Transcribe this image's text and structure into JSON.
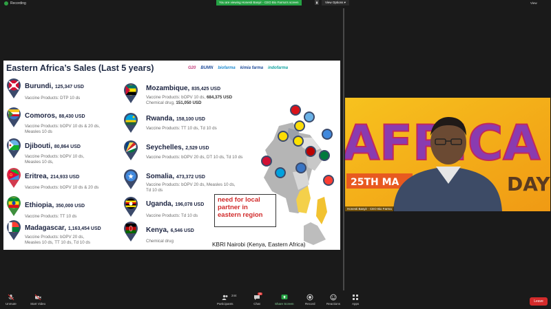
{
  "topbar": {
    "recording": "Recording",
    "viewing": "You are viewing Honesti Basyir - CEO Bio Farma's screen",
    "view_options": "View Options ▾",
    "view": "View"
  },
  "slide": {
    "title": "Eastern Africa’s Sales (Last 5 years)",
    "logos": [
      "G20",
      "BUMN",
      "biofarma",
      "kimia farma",
      "indofarma"
    ],
    "left": [
      {
        "country": "Burundi,",
        "amount": "125,347 USD",
        "products": [
          "Vaccine Products: DTP 10 ds"
        ]
      },
      {
        "country": "Comoros,",
        "amount": "88,430 USD",
        "products": [
          "Vaccine Products: bOPV 10 ds & 20 ds,",
          "Measles 10 ds"
        ]
      },
      {
        "country": "Djibouti,",
        "amount": "80,864 USD",
        "products": [
          "Vaccine Products: bOPV 10 ds,",
          "Measles 10 ds,"
        ]
      },
      {
        "country": "Eritrea,",
        "amount": "214,933 USD",
        "products": [
          "Vaccine Products: bOPV 10 ds & 20 ds"
        ]
      },
      {
        "country": "Ethiopia,",
        "amount": "350,000 USD",
        "products": [
          "Vaccine Products: TT 10 ds"
        ]
      },
      {
        "country": "Madagascar,",
        "amount": "1,163,454 USD",
        "products": [
          "Vaccine Products: bOPV 20 ds,",
          "Measles 10 ds, TT 10 ds, Td 10 ds"
        ]
      }
    ],
    "right": [
      {
        "country": "Mozambique,",
        "amount": "835,425 USD",
        "products": [
          "Vaccine Products: bOPV 10 ds,"
        ],
        "extra_amount": "684,375 USD",
        "chem": "Chemical drug,",
        "chem_amount": "151,050 USD"
      },
      {
        "country": "Rwanda,",
        "amount": "158,100 USD",
        "products": [
          "Vaccine Products: TT 10 ds, Td 10 ds"
        ]
      },
      {
        "country": "Seychelles,",
        "amount": "2,529 USD",
        "products": [
          "Vaccine Products: bOPV 20 ds, DT 10 ds, Td 10 ds"
        ]
      },
      {
        "country": "Somalia,",
        "amount": "473,372 USD",
        "products": [
          "Vaccine Products: bOPV 20 ds, Measles 10 ds,",
          "Td 10 ds"
        ]
      },
      {
        "country": "Uganda,",
        "amount": "196,078 USD",
        "products": [
          "Vaccine Products: Td 10 ds"
        ]
      },
      {
        "country": "Kenya,",
        "amount": "6,546 USD",
        "products": [
          "Chemical drug"
        ]
      }
    ],
    "callout": [
      "need for local",
      "partner in",
      "eastern region"
    ],
    "kbri": "KBRI Nairobi (Kenya, Eastern Africa)"
  },
  "speaker": {
    "name": "Honesti Basyir - CEO Bio Farma",
    "banner_text": "AFRICA",
    "day_text": "DAY",
    "date_text": "25TH MA"
  },
  "toolbar": {
    "unmute": "Unmute",
    "start_video": "Start Video",
    "participants": "Participants",
    "participants_count": "244",
    "chat": "Chat",
    "chat_count": "33",
    "share_screen": "Share Screen",
    "record": "Record",
    "reactions": "Reactions",
    "apps": "Apps",
    "leave": "Leave"
  },
  "colors": {
    "zoom_green": "#25a244",
    "leave_red": "#d32b2b",
    "callout_red": "#d12a2a",
    "title_navy": "#1f2a44"
  }
}
